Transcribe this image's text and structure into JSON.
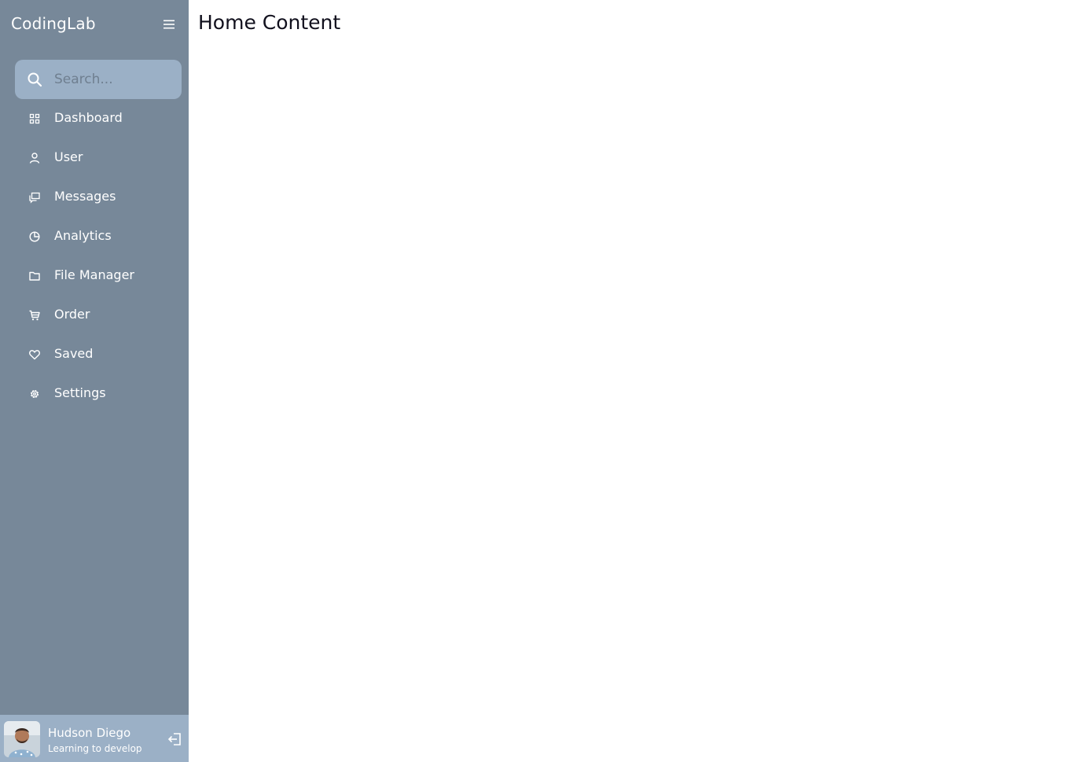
{
  "app": {
    "logo_text": "CodingLab"
  },
  "search": {
    "placeholder": "Search..."
  },
  "sidebar": {
    "items": [
      {
        "label": "Dashboard",
        "icon": "grid-icon"
      },
      {
        "label": "User",
        "icon": "user-icon"
      },
      {
        "label": "Messages",
        "icon": "chat-icon"
      },
      {
        "label": "Analytics",
        "icon": "pie-chart-icon"
      },
      {
        "label": "File Manager",
        "icon": "folder-icon"
      },
      {
        "label": "Order",
        "icon": "cart-icon"
      },
      {
        "label": "Saved",
        "icon": "heart-icon"
      },
      {
        "label": "Settings",
        "icon": "gear-icon"
      }
    ]
  },
  "profile": {
    "name": "Hudson Diego",
    "role": "Learning to develop"
  },
  "main": {
    "title": "Home Content"
  },
  "colors": {
    "sidebar_bg": "#778899",
    "search_bg": "#9bb0c6",
    "profile_bg": "#9bb0c6",
    "text_light": "#ffffff",
    "title_text": "#11101d"
  }
}
